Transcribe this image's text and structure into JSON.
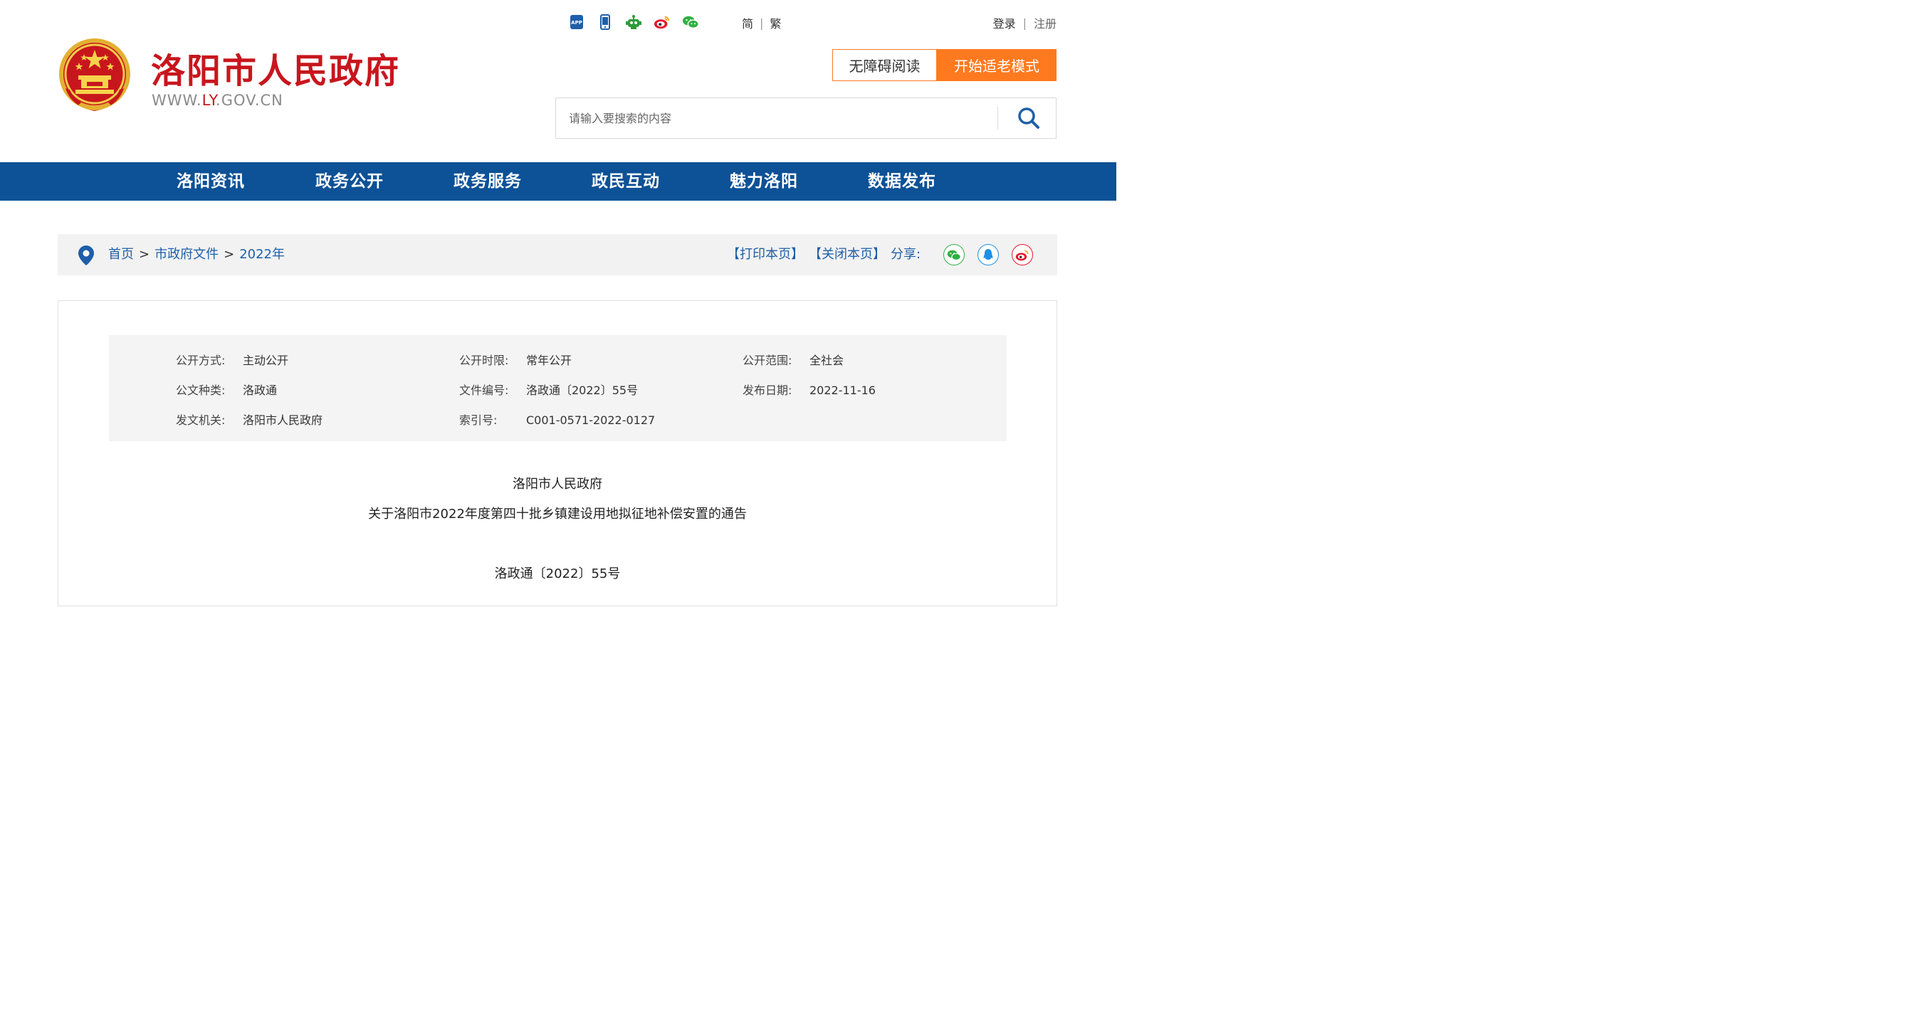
{
  "header": {
    "site_title": "洛阳市人民政府",
    "url_prefix": "WWW.",
    "url_highlight": "LY",
    "url_suffix": ".GOV.CN",
    "top_icons": [
      "app-icon",
      "mobile-icon",
      "robot-icon",
      "weibo-icon",
      "wechat-icon"
    ],
    "lang_simplified": "简",
    "lang_traditional": "繁",
    "login": "登录",
    "register": "注册",
    "accessible_reading": "无障碍阅读",
    "elder_mode": "开始适老模式",
    "search_placeholder": "请输入要搜索的内容",
    "accent_color": "#ff7a1f",
    "brand_red": "#c8161d"
  },
  "nav": {
    "color": "#0d5196",
    "items": [
      "洛阳资讯",
      "政务公开",
      "政务服务",
      "政民互动",
      "魅力洛阳",
      "数据发布"
    ]
  },
  "breadcrumb": {
    "home": "首页",
    "section": "市政府文件",
    "year": "2022年",
    "print": "【打印本页】",
    "close": "【关闭本页】",
    "share": "分享:",
    "share_icons": [
      "wechat-share-icon",
      "qq-share-icon",
      "weibo-share-icon"
    ]
  },
  "meta": {
    "disclosure_method_label": "公开方式:",
    "disclosure_method": "主动公开",
    "disclosure_period_label": "公开时限:",
    "disclosure_period": "常年公开",
    "disclosure_scope_label": "公开范围:",
    "disclosure_scope": "全社会",
    "doc_type_label": "公文种类:",
    "doc_type": "洛政通",
    "doc_number_label": "文件编号:",
    "doc_number": "洛政通〔2022〕55号",
    "publish_date_label": "发布日期:",
    "publish_date": "2022-11-16",
    "issuer_label": "发文机关:",
    "issuer": "洛阳市人民政府",
    "index_label": "索引号:",
    "index_no": "C001-0571-2022-0127"
  },
  "document": {
    "title_line1": "洛阳市人民政府",
    "title_line2": "关于洛阳市2022年度第四十批乡镇建设用地拟征地补偿安置的通告",
    "number": "洛政通〔2022〕55号"
  }
}
